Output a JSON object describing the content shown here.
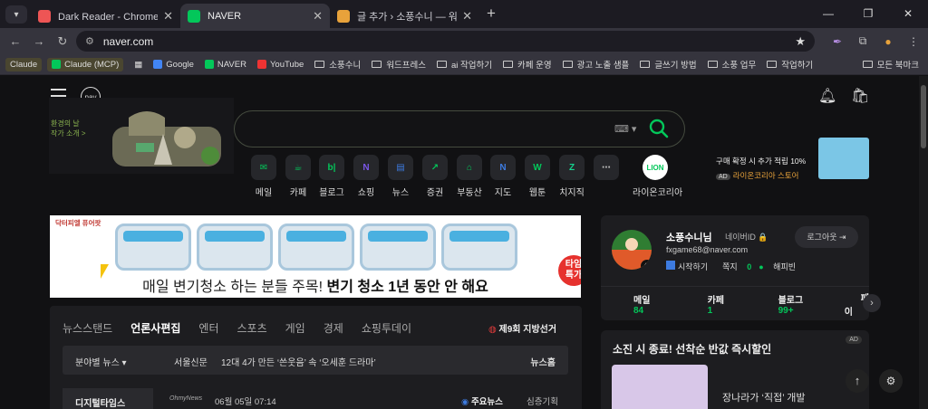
{
  "tabs": [
    {
      "title": "Dark Reader - Chrome 웹 스토어",
      "icon": "dark-reader-icon",
      "color": "#e55"
    },
    {
      "title": "NAVER",
      "icon": "naver-n-icon",
      "color": "#03c75a"
    },
    {
      "title": "글 추가 › 소풍수니 — 워드프레스",
      "icon": "wordpress-icon",
      "color": "#e8a23b"
    }
  ],
  "url": "naver.com",
  "bookmarks": [
    {
      "label": "Claude",
      "type": "chip"
    },
    {
      "label": "Claude (MCP)",
      "type": "chip"
    },
    {
      "label": "Google",
      "type": "site"
    },
    {
      "label": "NAVER",
      "type": "site"
    },
    {
      "label": "YouTube",
      "type": "site"
    },
    {
      "label": "소풍수니",
      "type": "folder"
    },
    {
      "label": "워드프레스",
      "type": "folder"
    },
    {
      "label": "ai 작업하기",
      "type": "folder"
    },
    {
      "label": "카페 운영",
      "type": "folder"
    },
    {
      "label": "광고 노출 샘플",
      "type": "folder"
    },
    {
      "label": "글쓰기 방법",
      "type": "folder"
    },
    {
      "label": "소풍 업무",
      "type": "folder"
    },
    {
      "label": "작업하기",
      "type": "folder"
    },
    {
      "label": "모든 북마크",
      "type": "folder"
    }
  ],
  "header": {
    "pay": "pay",
    "doodle_caption": "환경의 날\n작가 소개 >"
  },
  "services": [
    {
      "label": "메일",
      "glyph": "✉",
      "color": "#03c75a"
    },
    {
      "label": "카페",
      "glyph": "☕",
      "color": "#03c75a"
    },
    {
      "label": "블로그",
      "glyph": "b|",
      "color": "#03c75a"
    },
    {
      "label": "쇼핑",
      "glyph": "N",
      "color": "#7b57e8"
    },
    {
      "label": "뉴스",
      "glyph": "▤",
      "color": "#3d7be0"
    },
    {
      "label": "증권",
      "glyph": "↗",
      "color": "#03c75a"
    },
    {
      "label": "부동산",
      "glyph": "⌂",
      "color": "#03c75a"
    },
    {
      "label": "지도",
      "glyph": "N",
      "color": "#3d7be0"
    },
    {
      "label": "웹툰",
      "glyph": "W",
      "color": "#03c75a"
    },
    {
      "label": "치지직",
      "glyph": "Z",
      "color": "#15d38e"
    },
    {
      "label": "",
      "glyph": "⋯",
      "color": "#bbb"
    },
    {
      "label": "라이온코리아",
      "glyph": "LION",
      "color": "#03c75a"
    }
  ],
  "side_ad": {
    "line1": "구매 확정 시 추가 적립 10%",
    "ad": "AD",
    "line2": "라이온코리아 스토어"
  },
  "banner": {
    "brand": "닥터피엘 퓨어팟",
    "text_plain": "매일 변기청소 하는 분들 주목!",
    "text_bold": "변기 청소 1년 동안 안 해요",
    "sale": "타임\n특가"
  },
  "news": {
    "tabs": [
      "뉴스스탠드",
      "언론사편집",
      "엔터",
      "스포츠",
      "게임",
      "경제",
      "쇼핑투데이"
    ],
    "election": "제9회 지방선거",
    "category": "분야별 뉴스 ▾",
    "press": "서울신문",
    "headline": "12대 4가 만든 ‘쓴웃음’ 속 ‘오세훈 드라마’",
    "newshome": "뉴스홈",
    "row_pub": "디지털타임스",
    "row_logo": "OhmyNews",
    "row_time": "06월 05일 07:14",
    "row_main": "주요뉴스",
    "row_plan": "심층기획"
  },
  "user": {
    "name": "소풍수니님",
    "idlabel": "네이버ID 🔒",
    "email": "fxgame68@naver.com",
    "start": "시작하기",
    "note": "쪽지",
    "note_count": "0",
    "happybean": "해피빈",
    "logout": "로그아웃 ⇥",
    "stats": [
      {
        "label": "메일",
        "value": "84"
      },
      {
        "label": "카페",
        "value": "1"
      },
      {
        "label": "블로그",
        "value": "99+"
      },
      {
        "label": "페이",
        "value": ""
      }
    ]
  },
  "ad_box": {
    "title": "소진 시 종료! 선착순 반값 즉시할인",
    "ad": "AD",
    "desc": "장나라가 ‘직접’ 개발"
  }
}
